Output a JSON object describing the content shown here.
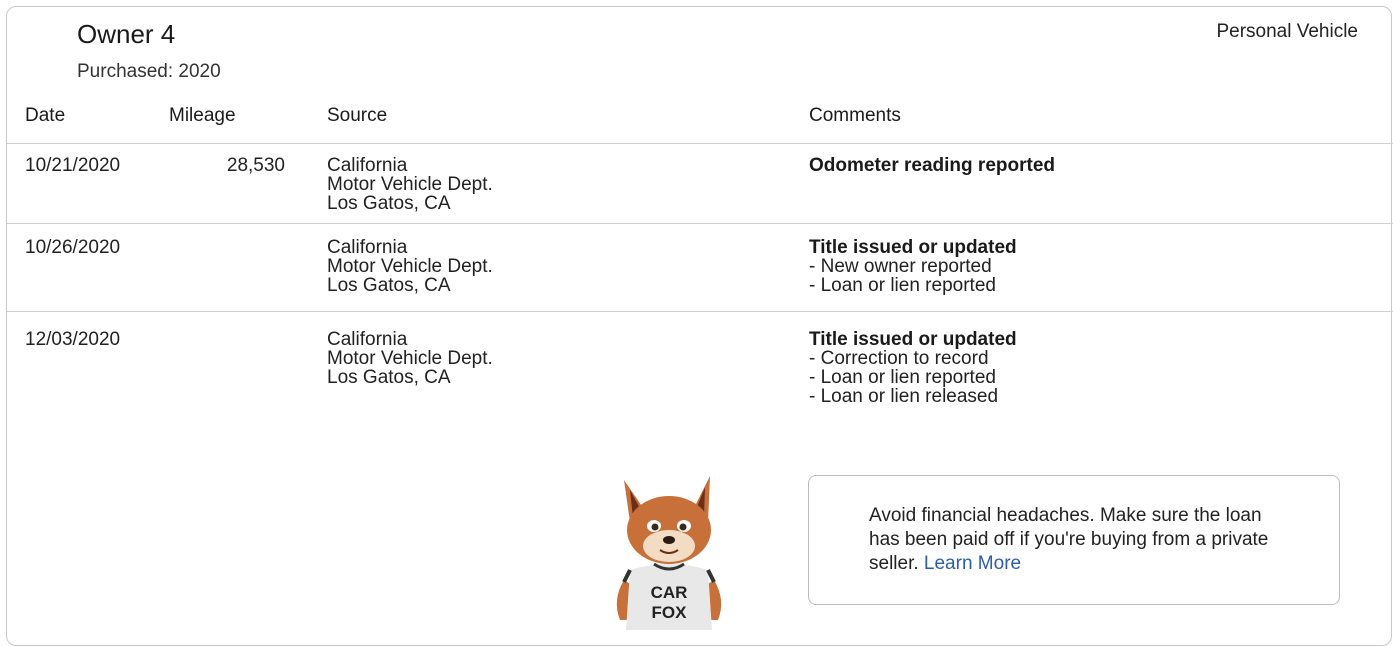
{
  "owner": {
    "title": "Owner 4",
    "purchased": "Purchased: 2020",
    "vehicle_type": "Personal Vehicle"
  },
  "table": {
    "headers": {
      "date": "Date",
      "mileage": "Mileage",
      "source": "Source",
      "comments": "Comments"
    },
    "rows": [
      {
        "date": "10/21/2020",
        "mileage": "28,530",
        "source": [
          "California",
          "Motor Vehicle Dept.",
          "Los Gatos, CA"
        ],
        "comment_title": "Odometer reading reported",
        "comment_items": []
      },
      {
        "date": "10/26/2020",
        "mileage": "",
        "source": [
          "California",
          "Motor Vehicle Dept.",
          "Los Gatos, CA"
        ],
        "comment_title": "Title issued or updated",
        "comment_items": [
          "- New owner reported",
          "- Loan or lien reported"
        ]
      },
      {
        "date": "12/03/2020",
        "mileage": "",
        "source": [
          "California",
          "Motor Vehicle Dept.",
          "Los Gatos, CA"
        ],
        "comment_title": "Title issued or updated",
        "comment_items": [
          "- Correction to record",
          "- Loan or lien reported",
          "- Loan or lien released"
        ]
      }
    ]
  },
  "callout": {
    "text": "Avoid financial headaches. Make sure the loan has been paid off if you're buying from a private seller.",
    "link": "Learn More",
    "shirt_line1": "CAR",
    "shirt_line2": "FOX"
  },
  "colors": {
    "link": "#2b5ea8",
    "border": "#cfcfcf",
    "fox_fur": "#c8703a"
  }
}
